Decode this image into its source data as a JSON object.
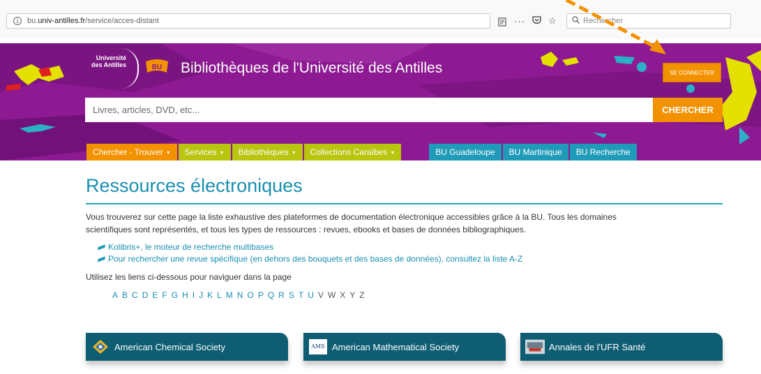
{
  "browser": {
    "url_host": "bu.",
    "url_domain": "univ-antilles.fr",
    "url_path": "/service/acces-distant",
    "search_placeholder": "Rechercher",
    "icons": [
      "info-icon",
      "reader-view-icon",
      "more-icon",
      "pocket-icon",
      "bookmark-star-icon",
      "search-icon"
    ]
  },
  "header": {
    "logo_line1": "Université",
    "logo_line2": "des Antilles",
    "bu_badge": "BU",
    "title": "Bibliothèques de l'Université des Antilles",
    "connect_label": "SE CONNECTER",
    "search_placeholder": "Livres, articles, DVD, etc...",
    "search_button": "CHERCHER"
  },
  "nav": {
    "tabs": [
      {
        "label": "Chercher - Trouver",
        "color": "#f39200",
        "dropdown": true
      },
      {
        "label": "Services",
        "color": "#b9c50e",
        "dropdown": true
      },
      {
        "label": "Bibliothèques",
        "color": "#b9c50e",
        "dropdown": true
      },
      {
        "label": "Collections Caraïbes",
        "color": "#b9c50e",
        "dropdown": true
      },
      {
        "label": "BU Guadeloupe",
        "color": "#1f9bb9",
        "dropdown": false
      },
      {
        "label": "BU Martinique",
        "color": "#1f9bb9",
        "dropdown": false
      },
      {
        "label": "BU Recherche",
        "color": "#1f9bb9",
        "dropdown": false
      }
    ]
  },
  "main": {
    "title": "Ressources électroniques",
    "intro_line1": "Vous trouverez sur cette page la liste exhaustive des plateformes de documentation électronique accessibles grâce à la BU. Tous les domaines",
    "intro_line2": "scientifiques sont représentés, et tous les types de ressources : revues, ebooks et bases de données bibliographiques.",
    "links": [
      "Kolibris+, le moteur de recherche multibases",
      "Pour rechercher une revue spécifique (en dehors des bouquets et des bases de données), consultez la liste A-Z"
    ],
    "nav_hint": "Utilisez les liens ci-dessous pour naviguer dans la page",
    "alphabet": [
      "A",
      "B",
      "C",
      "D",
      "E",
      "F",
      "G",
      "H",
      "I",
      "J",
      "K",
      "L",
      "M",
      "N",
      "O",
      "P",
      "Q",
      "R",
      "S",
      "T",
      "U",
      "V",
      "W",
      "X",
      "Y",
      "Z"
    ],
    "alphabet_inactive": [
      "V",
      "W",
      "X",
      "Y",
      "Z"
    ],
    "cards": [
      {
        "label": "American Chemical Society",
        "icon": "acs-logo-icon"
      },
      {
        "label": "American Mathematical Society",
        "icon": "ams-logo-icon",
        "icon_text": "AMS"
      },
      {
        "label": "Annales de l'UFR Santé",
        "icon": "ufr-sante-logo-icon"
      }
    ]
  },
  "annotation": {
    "arrow_color": "#f39200"
  }
}
